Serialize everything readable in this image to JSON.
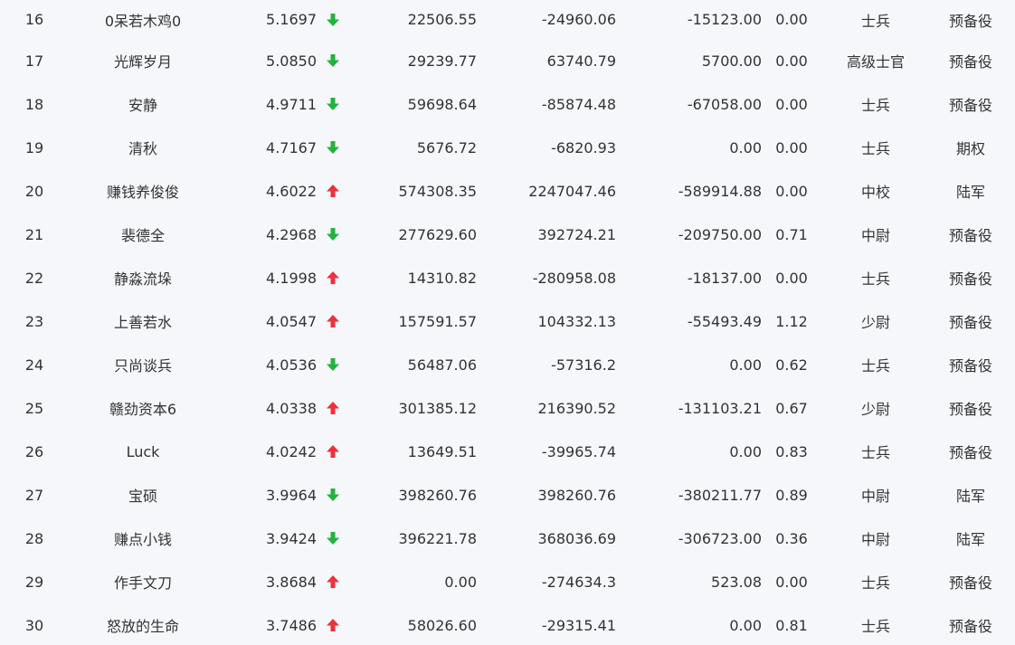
{
  "colors": {
    "background": "#f5f7fa",
    "text": "#333333",
    "up": "#f0303a",
    "down": "#1fb53a"
  },
  "icons": {
    "up": "arrow-up-icon",
    "down": "arrow-down-icon"
  },
  "rows": [
    {
      "rank": "16",
      "name": "0呆若木鸡0",
      "score": "5.1697",
      "trend": "down",
      "v1": "22506.55",
      "v2": "-24960.06",
      "v3": "-15123.00",
      "v4": "0.00",
      "title": "士兵",
      "type": "预备役"
    },
    {
      "rank": "17",
      "name": "光辉岁月",
      "score": "5.0850",
      "trend": "down",
      "v1": "29239.77",
      "v2": "63740.79",
      "v3": "5700.00",
      "v4": "0.00",
      "title": "高级士官",
      "type": "预备役"
    },
    {
      "rank": "18",
      "name": "安静",
      "score": "4.9711",
      "trend": "down",
      "v1": "59698.64",
      "v2": "-85874.48",
      "v3": "-67058.00",
      "v4": "0.00",
      "title": "士兵",
      "type": "预备役"
    },
    {
      "rank": "19",
      "name": "清秋",
      "score": "4.7167",
      "trend": "down",
      "v1": "5676.72",
      "v2": "-6820.93",
      "v3": "0.00",
      "v4": "0.00",
      "title": "士兵",
      "type": "期权"
    },
    {
      "rank": "20",
      "name": "赚钱养俊俊",
      "score": "4.6022",
      "trend": "up",
      "v1": "574308.35",
      "v2": "2247047.46",
      "v3": "-589914.88",
      "v4": "0.00",
      "title": "中校",
      "type": "陆军"
    },
    {
      "rank": "21",
      "name": "裴德全",
      "score": "4.2968",
      "trend": "down",
      "v1": "277629.60",
      "v2": "392724.21",
      "v3": "-209750.00",
      "v4": "0.71",
      "title": "中尉",
      "type": "预备役"
    },
    {
      "rank": "22",
      "name": "静淼流垛",
      "score": "4.1998",
      "trend": "up",
      "v1": "14310.82",
      "v2": "-280958.08",
      "v3": "-18137.00",
      "v4": "0.00",
      "title": "士兵",
      "type": "预备役"
    },
    {
      "rank": "23",
      "name": "上善若水",
      "score": "4.0547",
      "trend": "up",
      "v1": "157591.57",
      "v2": "104332.13",
      "v3": "-55493.49",
      "v4": "1.12",
      "title": "少尉",
      "type": "预备役"
    },
    {
      "rank": "24",
      "name": "只尚谈兵",
      "score": "4.0536",
      "trend": "down",
      "v1": "56487.06",
      "v2": "-57316.2",
      "v3": "0.00",
      "v4": "0.62",
      "title": "士兵",
      "type": "预备役"
    },
    {
      "rank": "25",
      "name": "赣劲资本6",
      "score": "4.0338",
      "trend": "up",
      "v1": "301385.12",
      "v2": "216390.52",
      "v3": "-131103.21",
      "v4": "0.67",
      "title": "少尉",
      "type": "预备役"
    },
    {
      "rank": "26",
      "name": "Luck",
      "score": "4.0242",
      "trend": "up",
      "v1": "13649.51",
      "v2": "-39965.74",
      "v3": "0.00",
      "v4": "0.83",
      "title": "士兵",
      "type": "预备役"
    },
    {
      "rank": "27",
      "name": "宝硕",
      "score": "3.9964",
      "trend": "down",
      "v1": "398260.76",
      "v2": "398260.76",
      "v3": "-380211.77",
      "v4": "0.89",
      "title": "中尉",
      "type": "陆军"
    },
    {
      "rank": "28",
      "name": "赚点小钱",
      "score": "3.9424",
      "trend": "down",
      "v1": "396221.78",
      "v2": "368036.69",
      "v3": "-306723.00",
      "v4": "0.36",
      "title": "中尉",
      "type": "陆军"
    },
    {
      "rank": "29",
      "name": "作手文刀",
      "score": "3.8684",
      "trend": "up",
      "v1": "0.00",
      "v2": "-274634.3",
      "v3": "523.08",
      "v4": "0.00",
      "title": "士兵",
      "type": "预备役"
    },
    {
      "rank": "30",
      "name": "怒放的生命",
      "score": "3.7486",
      "trend": "up",
      "v1": "58026.60",
      "v2": "-29315.41",
      "v3": "0.00",
      "v4": "0.81",
      "title": "士兵",
      "type": "预备役"
    }
  ]
}
